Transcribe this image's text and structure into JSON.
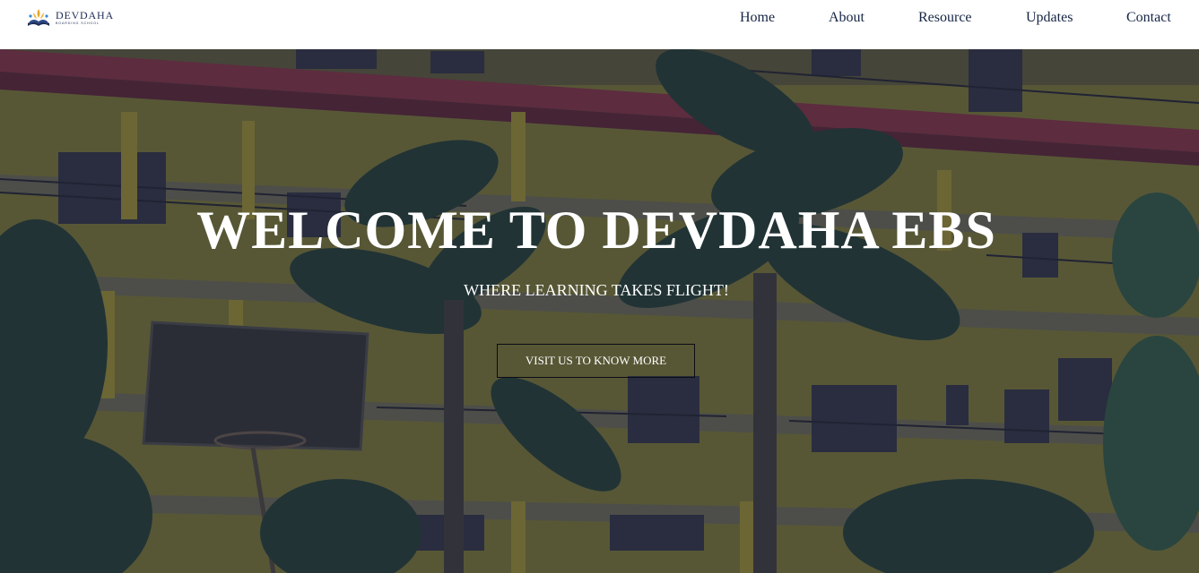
{
  "brand": {
    "name": "DEVDAHA",
    "subtitle": "BOARDING SCHOOL",
    "logo_icon": "school-emblem-icon"
  },
  "nav": {
    "home": "Home",
    "about": "About",
    "resource": "Resource",
    "updates": "Updates",
    "contact": "Contact"
  },
  "hero": {
    "title": "WELCOME TO DEVDAHA EBS",
    "subtitle": "WHERE LEARNING TAKES FLIGHT!",
    "cta_label": "VISIT US TO KNOW MORE",
    "background": "photo of yellow school building with red roof and palm trees"
  },
  "colors": {
    "nav_text": "#162544",
    "hero_text": "#ffffff",
    "overlay": "#14183a"
  }
}
